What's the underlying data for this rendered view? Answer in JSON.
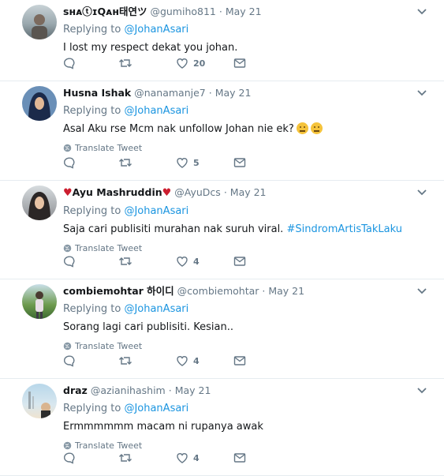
{
  "tweets": [
    {
      "name": "sʜᴀⓣɪQᴀʜ태연ツ",
      "handle": "@gumiho811",
      "dot": "·",
      "date": "May 21",
      "replying_prefix": "Replying to",
      "replying_to": "@JohanAsari",
      "text": "I lost my respect dekat you johan.",
      "translate": "",
      "likes": "20",
      "avatar_icon": "person-photo"
    },
    {
      "name": "Husna Ishak",
      "handle": "@nanamanje7",
      "dot": "·",
      "date": "May 21",
      "replying_prefix": "Replying to",
      "replying_to": "@JohanAsari",
      "text": "Asal Aku rse Mcm nak unfollow Johan nie ek?",
      "translate": "Translate Tweet",
      "likes": "5",
      "avatar_icon": "hijab-person-photo"
    },
    {
      "name": "Ayu Mashruddin",
      "handle": "@AyuDcs",
      "dot": "·",
      "date": "May 21",
      "replying_prefix": "Replying to",
      "replying_to": "@JohanAsari",
      "text": "Saja cari publisiti murahan nak suruh viral.",
      "hashtag": "#SindromArtisTakLaku",
      "translate": "Translate Tweet",
      "likes": "4",
      "avatar_icon": "hijab-person-photo"
    },
    {
      "name": "combiemohtar 하이디",
      "handle": "@combiemohtar",
      "dot": "·",
      "date": "May 21",
      "replying_prefix": "Replying to",
      "replying_to": "@JohanAsari",
      "text": "Sorang lagi cari publisiti. Kesian..",
      "translate": "Translate Tweet",
      "likes": "4",
      "avatar_icon": "outdoor-person-photo"
    },
    {
      "name": "draz",
      "handle": "@azianihashim",
      "dot": "·",
      "date": "May 21",
      "replying_prefix": "Replying to",
      "replying_to": "@JohanAsari",
      "text": "Ermmmmmm macam ni rupanya awak",
      "translate": "Translate Tweet",
      "likes": "4",
      "avatar_icon": "beach-photo"
    }
  ],
  "colors": {
    "link": "#1b95e0",
    "muted": "#657786",
    "text": "#14171a",
    "divider": "#e6ecf0",
    "heart_emoji": "#cc1e2f"
  }
}
